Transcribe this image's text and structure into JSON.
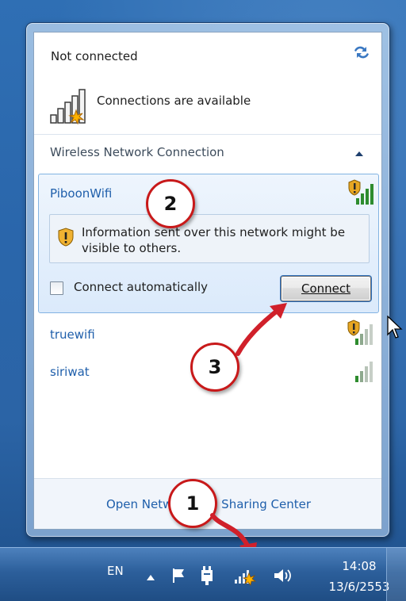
{
  "flyout": {
    "status_title": "Not connected",
    "status_subtitle": "Connections are available",
    "section_title": "Wireless Network Connection",
    "selected_network": {
      "name": "PiboonWifi",
      "warning": "Information sent over this network might be visible to others.",
      "auto_connect_label": "Connect automatically",
      "auto_connect_checked": false,
      "connect_button": "Connect"
    },
    "networks": [
      {
        "name": "truewifi",
        "secured": true
      },
      {
        "name": "siriwat",
        "secured": false
      }
    ],
    "footer_link": "Open Network and Sharing Center"
  },
  "callouts": [
    "1",
    "2",
    "3"
  ],
  "taskbar": {
    "language": "EN",
    "time": "14:08",
    "date": "13/6/2553",
    "icons": [
      "show-hidden-icons",
      "action-center-flag",
      "power-plug",
      "network-wifi",
      "volume"
    ]
  },
  "colors": {
    "link": "#1f5fab",
    "callout_border": "#c8191a",
    "arrow": "#d0202a",
    "taskbar": "#2c5f9b"
  }
}
